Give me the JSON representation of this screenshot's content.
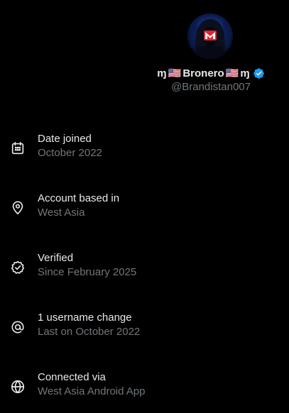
{
  "profile": {
    "display_name_prefix": "ɱ",
    "display_name_flag_1": "🇺🇸",
    "display_name": "Bronero",
    "display_name_flag_2": "🇺🇸",
    "display_name_suffix": "ɱ",
    "handle": "@Brandistan007",
    "avatar_icon": "hooded-figure-mask-avatar",
    "verified_icon": "verified-badge-icon",
    "verified_color": "#1d9bf0"
  },
  "about": {
    "items": [
      {
        "icon": "calendar-icon",
        "title": "Date joined",
        "subtitle": "October 2022"
      },
      {
        "icon": "location-pin-icon",
        "title": "Account based in",
        "subtitle": "West Asia"
      },
      {
        "icon": "verified-check-icon",
        "title": "Verified",
        "subtitle": "Since February 2025"
      },
      {
        "icon": "at-sign-icon",
        "title": "1 username change",
        "subtitle": "Last on October 2022"
      },
      {
        "icon": "globe-icon",
        "title": "Connected via",
        "subtitle": "West Asia Android App"
      }
    ]
  },
  "colors": {
    "background": "#000000",
    "primary_text": "#e7e9ea",
    "secondary_text": "#71767b",
    "accent": "#1d9bf0"
  }
}
